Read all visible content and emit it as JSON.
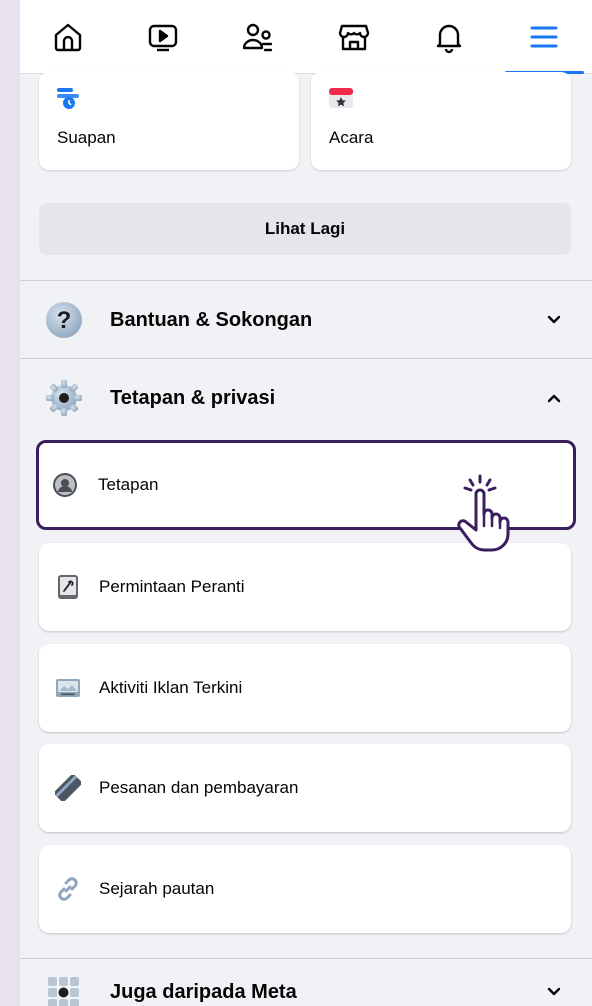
{
  "nav": {
    "tabs": [
      {
        "name": "home",
        "icon": "home-icon"
      },
      {
        "name": "video",
        "icon": "video-icon"
      },
      {
        "name": "friends",
        "icon": "friends-icon"
      },
      {
        "name": "marketplace",
        "icon": "marketplace-icon"
      },
      {
        "name": "notifications",
        "icon": "bell-icon"
      },
      {
        "name": "menu",
        "icon": "menu-icon",
        "active": true
      }
    ]
  },
  "shortcuts": [
    {
      "label": "Suapan",
      "icon": "feeds-icon"
    },
    {
      "label": "Acara",
      "icon": "events-icon"
    }
  ],
  "see_more_label": "Lihat Lagi",
  "sections": {
    "help": {
      "label": "Bantuan & Sokongan",
      "icon": "help-icon",
      "expanded": false
    },
    "settings": {
      "label": "Tetapan & privasi",
      "icon": "settings-gear-icon",
      "expanded": true
    },
    "meta": {
      "label": "Juga daripada Meta",
      "icon": "meta-apps-icon",
      "expanded": false
    }
  },
  "settings_items": [
    {
      "label": "Tetapan",
      "icon": "account-icon",
      "highlighted": true
    },
    {
      "label": "Permintaan Peranti",
      "icon": "device-icon"
    },
    {
      "label": "Aktiviti Iklan Terkini",
      "icon": "ad-activity-icon"
    },
    {
      "label": "Pesanan dan pembayaran",
      "icon": "payment-card-icon"
    },
    {
      "label": "Sejarah pautan",
      "icon": "link-icon"
    }
  ],
  "colors": {
    "accent": "#1877f2",
    "highlight_border": "#3b1f5c",
    "page_bg": "#f0f2f5",
    "outer_bg": "#e8e2ef"
  }
}
